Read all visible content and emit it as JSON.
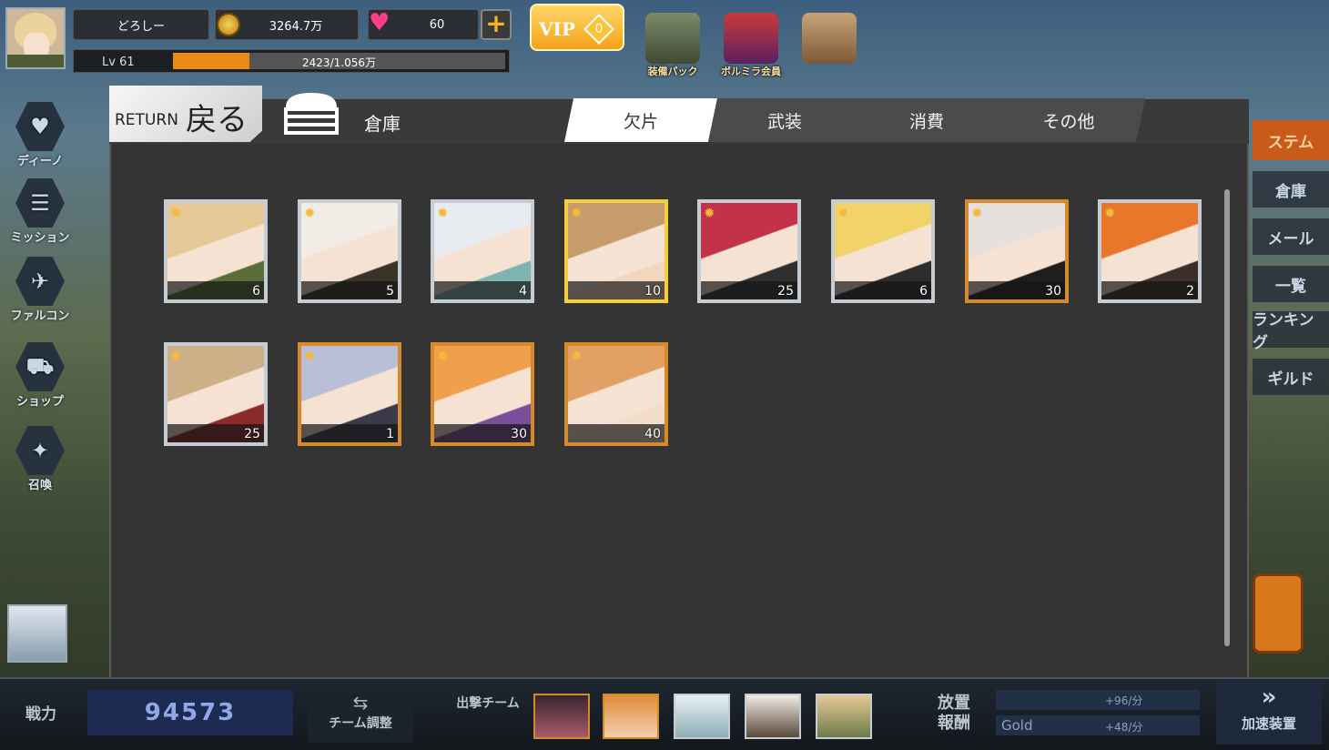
{
  "player": {
    "name": "どろしー",
    "level_label": "Lv 61",
    "exp_text": "2423/1.056万",
    "exp_progress": 0.23,
    "gold": "3264.7万",
    "hearts": "60"
  },
  "vip": {
    "label": "VIP",
    "level": "0"
  },
  "top_icons": [
    {
      "label": "装備パック",
      "icon": "missile-pack-icon"
    },
    {
      "label": "ボルミラ会員",
      "icon": "member-card-icon"
    },
    {
      "label": "",
      "icon": "box-icon"
    }
  ],
  "side_menu": [
    {
      "label": "ディーノ",
      "icon": "wing-heart-icon"
    },
    {
      "label": "ミッション",
      "icon": "clipboard-icon"
    },
    {
      "label": "ファルコン",
      "icon": "falcon-icon"
    },
    {
      "label": "ショップ",
      "icon": "cart-icon"
    },
    {
      "label": "召喚",
      "icon": "summon-icon"
    }
  ],
  "right_menu": [
    "ステム",
    "倉庫",
    "メール",
    "一覧",
    "ランキング",
    "ギルド"
  ],
  "panel": {
    "return_en": "RETURN",
    "return_jp": "戻る",
    "title": "倉庫",
    "tabs": [
      {
        "label": "欠片",
        "active": true
      },
      {
        "label": "武装",
        "active": false
      },
      {
        "label": "消費",
        "active": false
      },
      {
        "label": "その他",
        "active": false
      }
    ],
    "items": [
      {
        "qty": "6",
        "rarity": "silver",
        "hair": "#e6c896",
        "accent": "#5b6e3a"
      },
      {
        "qty": "5",
        "rarity": "silver",
        "hair": "#f0ece6",
        "accent": "#3a332a"
      },
      {
        "qty": "4",
        "rarity": "silver",
        "hair": "#e8ecf0",
        "accent": "#7fb3b0"
      },
      {
        "qty": "10",
        "rarity": "gold",
        "hair": "#c79c6c",
        "accent": "#f1d6c0"
      },
      {
        "qty": "25",
        "rarity": "silver",
        "hair": "#c2334a",
        "accent": "#2f2f2f"
      },
      {
        "qty": "6",
        "rarity": "silver",
        "hair": "#f1d36a",
        "accent": "#2c2c2c"
      },
      {
        "qty": "30",
        "rarity": "bronze",
        "hair": "#e6e1dc",
        "accent": "#1e1e1e"
      },
      {
        "qty": "2",
        "rarity": "silver",
        "hair": "#e8772c",
        "accent": "#3b2f2a"
      },
      {
        "qty": "25",
        "rarity": "silver",
        "hair": "#cdb088",
        "accent": "#8a2a2a"
      },
      {
        "qty": "1",
        "rarity": "bronze",
        "hair": "#b8bfd6",
        "accent": "#3a3a4a"
      },
      {
        "qty": "30",
        "rarity": "bronze",
        "hair": "#f0a04a",
        "accent": "#7a4e9a"
      },
      {
        "qty": "40",
        "rarity": "bronze",
        "hair": "#e2a064",
        "accent": "#f2ddc8"
      }
    ]
  },
  "bottom": {
    "power_label": "戦力",
    "power_value": "94573",
    "team_label": "チーム調整",
    "sortie_label": "出撃チーム",
    "idle_label": "放置報酬",
    "rate_top": "+96/分",
    "gold_label": "Gold",
    "rate_bottom": "+48/分",
    "speed_label": "加速装置"
  },
  "colors": {
    "accent": "#e98a14",
    "tab_active": "#ffffff",
    "panel_bg": "#343434",
    "rarity_gold": "#f3cf3a",
    "rarity_bronze": "#d88a2a",
    "rarity_silver": "#c6ccd3"
  }
}
